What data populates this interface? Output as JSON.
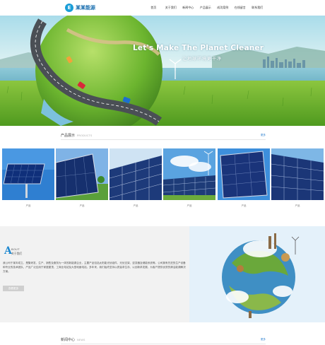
{
  "brand": {
    "logo_text": "某某能源",
    "logo_mark": "E"
  },
  "nav": {
    "items": [
      {
        "label": "首页"
      },
      {
        "label": "关于我们"
      },
      {
        "label": "新闻中心"
      },
      {
        "label": "产品展示"
      },
      {
        "label": "成功案例"
      },
      {
        "label": "在线留言"
      },
      {
        "label": "联系我们"
      }
    ]
  },
  "hero": {
    "title": "Let's Make The Planet Cleaner",
    "subtitle": "让地球环境更干净"
  },
  "products": {
    "title": "产品展示",
    "subtitle": "PRODUCTS",
    "more": "更多",
    "items": [
      {
        "caption": "产品"
      },
      {
        "caption": "产品"
      },
      {
        "caption": "产品"
      },
      {
        "caption": "产品"
      },
      {
        "caption": "产品"
      },
      {
        "caption": "产品"
      }
    ]
  },
  "about": {
    "letter": "A",
    "title_en": "BOUT",
    "title_cn": "关于我们",
    "text": "我公司于某年成立，是集研发、生产、销售及服务为一体的新能源企业，主要产品包括太阳能光伏组件、光伏支架、逆变器及储能系统等。公司拥有先进的生产设备和专业的技术团队，产品广泛应用于家庭屋顶、工商业电站及大型地面电站。多年来，我们始终坚持以质量求生存、以创新求发展，为客户提供优质的清洁能源解决方案。",
    "button": "查看更多"
  },
  "news": {
    "title": "新闻中心",
    "subtitle": "NEWS",
    "more": "更多"
  },
  "colors": {
    "accent": "#1e88d0",
    "link": "#2a7fd0",
    "about_bg": "#f2f2f2"
  }
}
